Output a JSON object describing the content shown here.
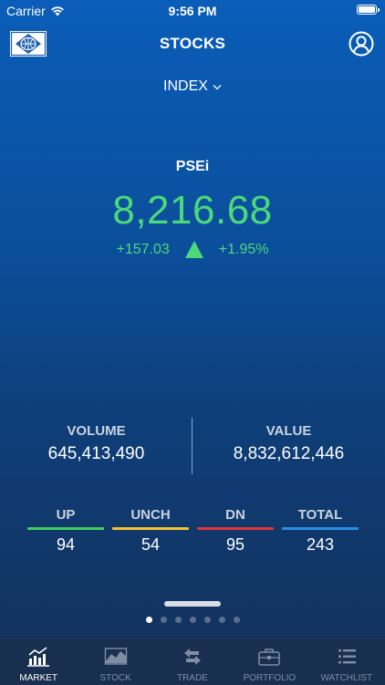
{
  "status_bar": {
    "carrier": "Carrier",
    "time": "9:56 PM",
    "battery_level": 1.0
  },
  "header": {
    "title": "STOCKS",
    "logo_icon": "pse-logo",
    "profile_icon": "profile-icon"
  },
  "dropdown": {
    "label": "INDEX"
  },
  "index": {
    "name": "PSEi",
    "value": "8,216.68",
    "change": "+157.03",
    "percent": "+1.95%",
    "direction": "up",
    "color": "#4cd97a"
  },
  "stats": {
    "volume_label": "VOLUME",
    "volume": "645,413,490",
    "value_label": "VALUE",
    "value": "8,832,612,446"
  },
  "breadth": [
    {
      "label": "UP",
      "value": "94",
      "color": "#3ecf5c"
    },
    {
      "label": "UNCH",
      "value": "54",
      "color": "#f2c230"
    },
    {
      "label": "DN",
      "value": "95",
      "color": "#e0343a"
    },
    {
      "label": "TOTAL",
      "value": "243",
      "color": "#2a8de0"
    }
  ],
  "pager": {
    "count": 7,
    "active": 0
  },
  "tabs": [
    {
      "label": "MARKET",
      "icon": "market-icon",
      "active": true
    },
    {
      "label": "STOCK",
      "icon": "stock-icon",
      "active": false
    },
    {
      "label": "TRADE",
      "icon": "trade-icon",
      "active": false
    },
    {
      "label": "PORTFOLIO",
      "icon": "portfolio-icon",
      "active": false
    },
    {
      "label": "WATCHLIST",
      "icon": "watchlist-icon",
      "active": false
    }
  ]
}
